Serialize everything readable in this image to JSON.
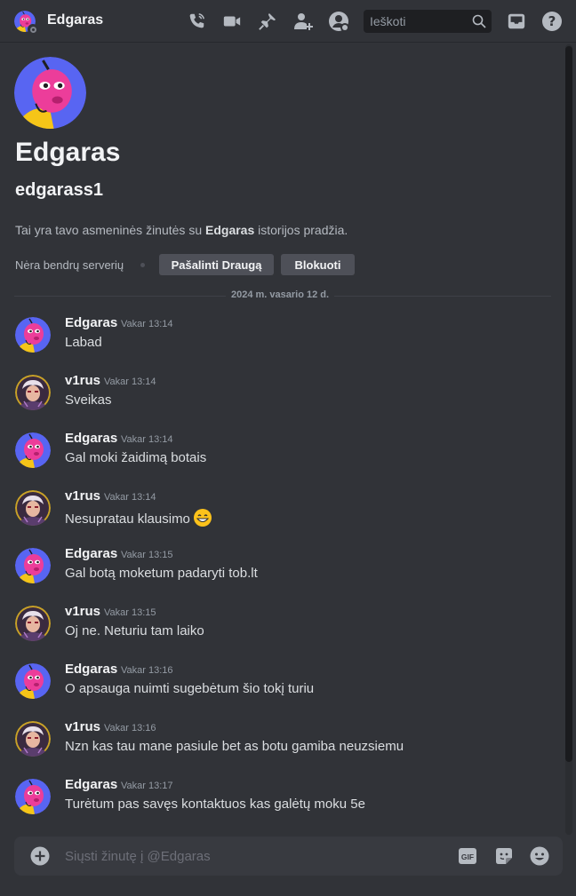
{
  "header": {
    "title": "Edgaras",
    "search_placeholder": "Ieškoti",
    "icons": [
      "voice-call-icon",
      "video-call-icon",
      "pin-icon",
      "add-friend-icon",
      "profile-icon",
      "inbox-icon",
      "help-icon"
    ]
  },
  "intro": {
    "display_name": "Edgaras",
    "username": "edgarass1",
    "desc_prefix": "Tai yra tavo asmeninės žinutės su ",
    "desc_name": "Edgaras",
    "desc_suffix": " istorijos pradžia.",
    "mutual_servers": "Nėra bendrų serverių",
    "remove_friend_label": "Pašalinti Draugą",
    "block_label": "Blokuoti"
  },
  "date_divider": "2024 m. vasario 12 d.",
  "messages": [
    {
      "author": "Edgaras",
      "time": "Vakar 13:14",
      "text": "Labad"
    },
    {
      "author": "v1rus",
      "time": "Vakar 13:14",
      "text": "Sveikas"
    },
    {
      "author": "Edgaras",
      "time": "Vakar 13:14",
      "text": "Gal moki žaidimą botais"
    },
    {
      "author": "v1rus",
      "time": "Vakar 13:14",
      "text": "Nesupratau klausimo"
    },
    {
      "author": "Edgaras",
      "time": "Vakar 13:15",
      "text": "Gal botą moketum padaryti tob.lt"
    },
    {
      "author": "v1rus",
      "time": "Vakar 13:15",
      "text": "Oj ne. Neturiu tam laiko"
    },
    {
      "author": "Edgaras",
      "time": "Vakar 13:16",
      "text": "O apsauga nuimti sugebėtum šio tokį turiu"
    },
    {
      "author": "v1rus",
      "time": "Vakar 13:16",
      "text": "Nzn kas tau mane pasiule bet as botu gamiba neuzsiemu"
    },
    {
      "author": "Edgaras",
      "time": "Vakar 13:17",
      "text": "Turėtum pas savęs kontaktuos kas galėtų moku 5e"
    }
  ],
  "composer": {
    "placeholder": "Siųsti žinutę į @Edgaras",
    "gif_label": "GIF"
  },
  "colors": {
    "background": "#313338",
    "header_text": "#f2f3f5",
    "muted": "#949ba4",
    "button": "#4e5058",
    "input": "#383a40"
  }
}
